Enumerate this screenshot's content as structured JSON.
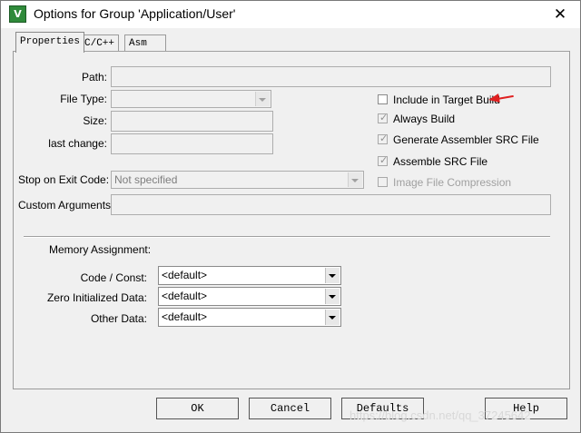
{
  "window": {
    "title": "Options for Group 'Application/User'",
    "close_glyph": "✕",
    "icon_letter": "V"
  },
  "tabs": [
    {
      "label": "Properties",
      "active": true
    },
    {
      "label": "C/C++",
      "active": false
    },
    {
      "label": "Asm",
      "active": false
    }
  ],
  "properties": {
    "path_label": "Path:",
    "path_value": "",
    "file_type_label": "File Type:",
    "file_type_value": "",
    "size_label": "Size:",
    "size_value": "",
    "last_change_label": "last change:",
    "last_change_value": "",
    "stop_on_exit_label": "Stop on Exit Code:",
    "stop_on_exit_value": "Not specified",
    "custom_args_label": "Custom Arguments:",
    "custom_args_value": ""
  },
  "checkboxes": [
    {
      "label": "Include in Target Build",
      "checked": false,
      "enabled": true
    },
    {
      "label": "Always Build",
      "checked": true,
      "enabled": true
    },
    {
      "label": "Generate Assembler SRC File",
      "checked": true,
      "enabled": true
    },
    {
      "label": "Assemble SRC File",
      "checked": true,
      "enabled": true
    },
    {
      "label": "Image File Compression",
      "checked": false,
      "enabled": false
    }
  ],
  "memory": {
    "heading": "Memory Assignment:",
    "code_label": "Code / Const:",
    "code_value": "<default>",
    "zero_label": "Zero Initialized Data:",
    "zero_value": "<default>",
    "other_label": "Other Data:",
    "other_value": "<default>"
  },
  "buttons": {
    "ok": "OK",
    "cancel": "Cancel",
    "defaults": "Defaults",
    "help": "Help"
  },
  "annotation": {
    "arrow_color": "#e02020"
  },
  "watermark": "https://blog.csdn.net/qq_37245642"
}
